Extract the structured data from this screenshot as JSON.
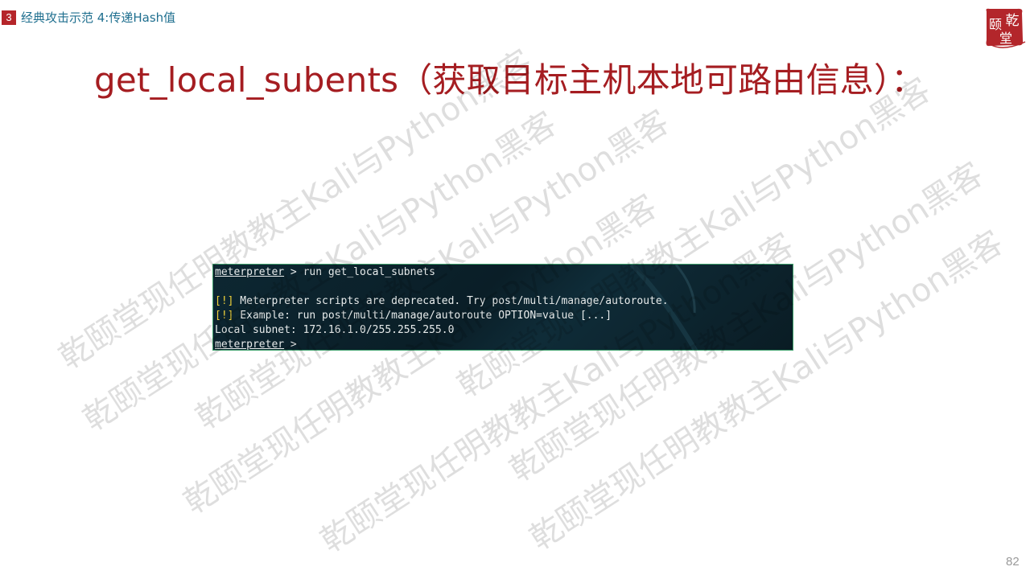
{
  "breadcrumb": {
    "section_number": "3",
    "text": "经典攻击示范 4:传递Hash值"
  },
  "logo": {
    "text_top": "乾",
    "text_left": "颐",
    "text_bottom": "堂"
  },
  "title": "get_local_subents（获取目标主机本地可路由信息）：",
  "watermark": {
    "text": "乾颐堂现任明教教主Kali与Python黑客"
  },
  "terminal": {
    "line1_prompt": "meterpreter",
    "line1_cmd": " > run get_local_subnets",
    "line2": "",
    "line3_flag": "[!]",
    "line3_text": " Meterpreter scripts are deprecated. Try post/multi/manage/autoroute.",
    "line4_flag": "[!]",
    "line4_text": " Example: run post/multi/manage/autoroute OPTION=value [...]",
    "line5": "Local subnet: 172.16.1.0/255.255.255.0",
    "line6_prompt": "meterpreter",
    "line6_cmd": " >"
  },
  "page_number": "82",
  "colors": {
    "title": "#a51d21",
    "breadcrumb": "#1f6f8f",
    "badge": "#b5252a",
    "terminal_bg": "#0d2732",
    "terminal_border": "#3ea06b",
    "warn": "#f0d23a"
  }
}
